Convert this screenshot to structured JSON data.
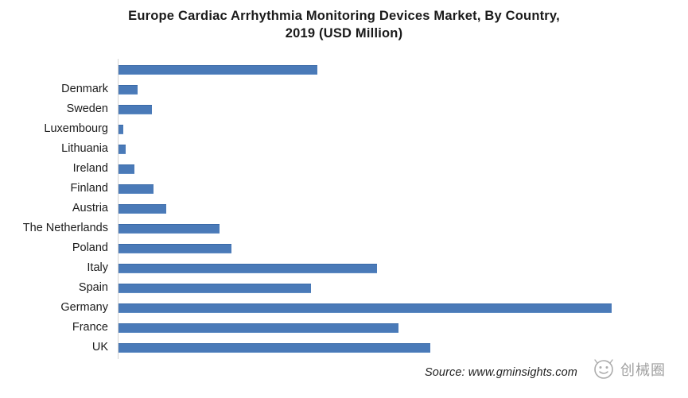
{
  "chart_data": {
    "type": "bar",
    "orientation": "horizontal",
    "title": "Europe Cardiac Arrhythmia Monitoring Devices Market, By Country, 2019 (USD Million)",
    "title_line1": "Europe Cardiac Arrhythmia Monitoring Devices Market, By Country,",
    "title_line2": "2019 (USD Million)",
    "xlabel": "",
    "ylabel": "",
    "unit": "USD Million",
    "year": "2019",
    "grid": false,
    "legend": null,
    "xlim": [
      0,
      620
    ],
    "axis_line_color": "#d4d4d4",
    "bar_color": "#4a7ab8",
    "categories": [
      "",
      "Denmark",
      "Sweden",
      "Luxembourg",
      "Lithuania",
      "Ireland",
      "Finland",
      "Austria",
      "The Netherlands",
      "Poland",
      "Italy",
      "Spain",
      "Germany",
      "France",
      "UK"
    ],
    "values": [
      250,
      24,
      42,
      6,
      9,
      20,
      44,
      60,
      127,
      142,
      325,
      242,
      620,
      352,
      392
    ],
    "points": [
      {
        "category": "",
        "value": 250
      },
      {
        "category": "Denmark",
        "value": 24
      },
      {
        "category": "Sweden",
        "value": 42
      },
      {
        "category": "Luxembourg",
        "value": 6
      },
      {
        "category": "Lithuania",
        "value": 9
      },
      {
        "category": "Ireland",
        "value": 20
      },
      {
        "category": "Finland",
        "value": 44
      },
      {
        "category": "Austria",
        "value": 60
      },
      {
        "category": "The Netherlands",
        "value": 127
      },
      {
        "category": "Poland",
        "value": 142
      },
      {
        "category": "Italy",
        "value": 325
      },
      {
        "category": "Spain",
        "value": 242
      },
      {
        "category": "Germany",
        "value": 620
      },
      {
        "category": "France",
        "value": 352
      },
      {
        "category": "UK",
        "value": 392
      }
    ]
  },
  "footer": {
    "source": "Source: www.gminsights.com"
  },
  "watermark": {
    "text": "创械圈",
    "logo": "smiley-circle-icon"
  }
}
